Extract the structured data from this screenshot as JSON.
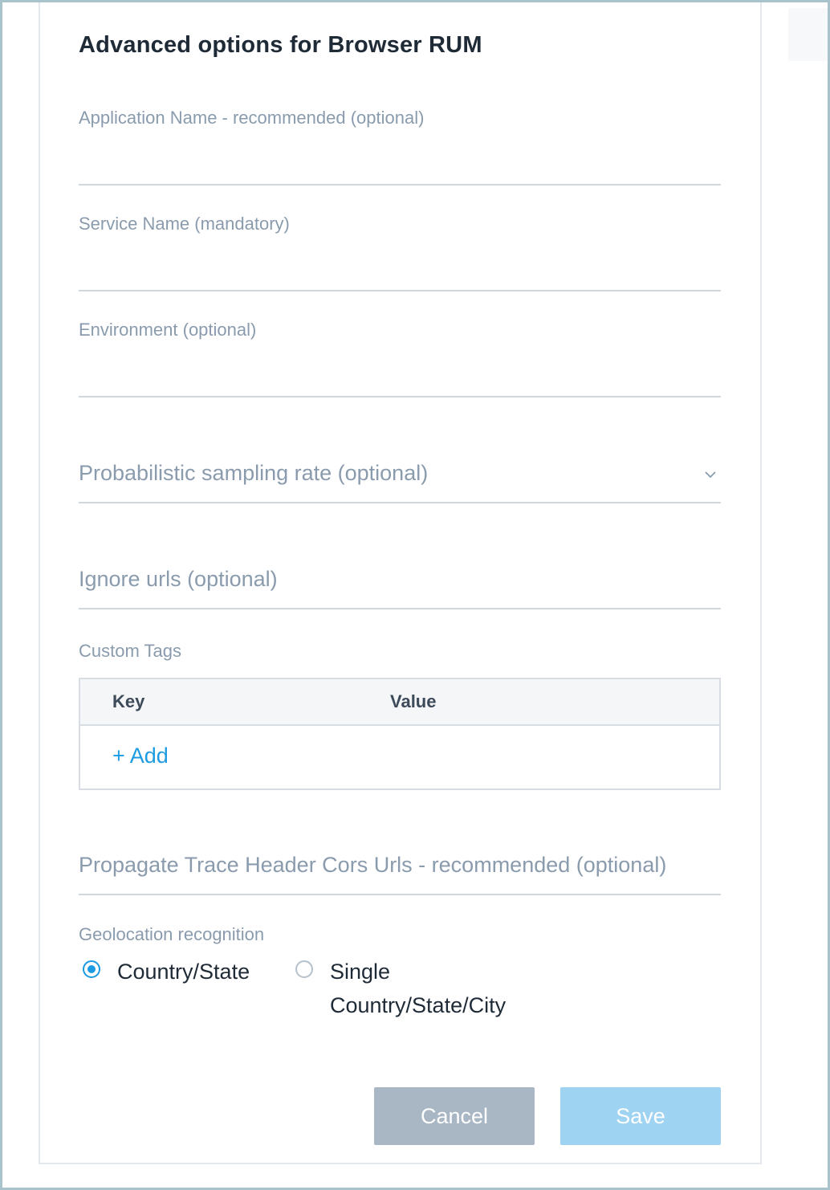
{
  "dialog": {
    "title": "Advanced options for Browser RUM"
  },
  "fields": {
    "application_name": {
      "label": "Application Name - recommended (optional)",
      "value": ""
    },
    "service_name": {
      "label": "Service Name (mandatory)",
      "value": ""
    },
    "environment": {
      "label": "Environment (optional)",
      "value": ""
    },
    "sampling_rate": {
      "placeholder": "Probabilistic sampling rate (optional)",
      "icon": "chevron-down-icon"
    },
    "ignore_urls": {
      "placeholder": "Ignore urls (optional)"
    },
    "propagate_cors": {
      "placeholder": "Propagate Trace Header Cors Urls - recommended (optional)"
    }
  },
  "custom_tags": {
    "label": "Custom Tags",
    "columns": [
      "Key",
      "Value"
    ],
    "add_label": "+ Add"
  },
  "geolocation": {
    "label": "Geolocation recognition",
    "options": [
      {
        "line1": "Country/State",
        "line2": "",
        "selected": true
      },
      {
        "line1": "Single",
        "line2": "Country/State/City",
        "selected": false
      }
    ]
  },
  "buttons": {
    "cancel_label": "Cancel",
    "save_label": "Save"
  },
  "colors": {
    "accent": "#1d9be2",
    "cancel_bg": "#a9b7c5",
    "save_bg": "#9fd3f2",
    "label": "#8a9bad"
  }
}
